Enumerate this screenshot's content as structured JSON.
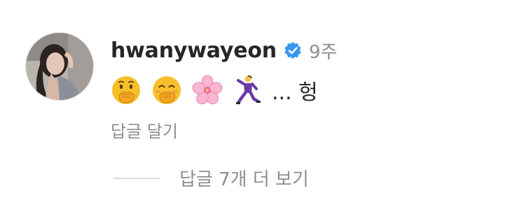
{
  "comment": {
    "username": "hwanywayeon",
    "verified_icon": "verified-badge-icon",
    "accent_color": "#3897f0",
    "time": "9주",
    "emojis": [
      "face-with-hand-over-mouth-icon",
      "smiling-face-with-hand-over-mouth-icon",
      "cherry-blossom-icon",
      "dancing-man-icon"
    ],
    "text": "... 헝",
    "reply_label": "답글 달기",
    "view_replies_label": "답글 7개 더 보기"
  }
}
